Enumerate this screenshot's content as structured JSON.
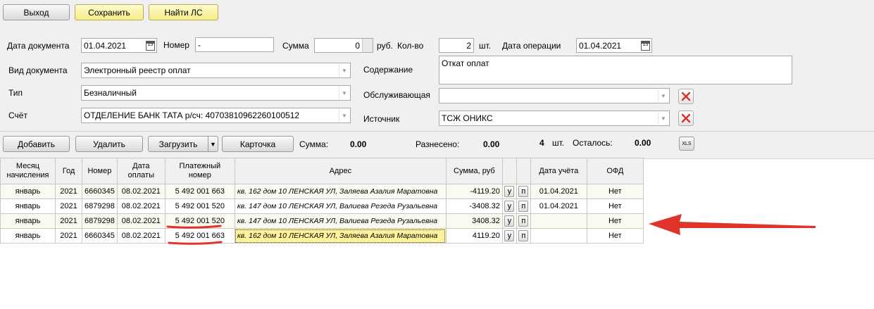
{
  "toolbar": {
    "exit_label": "Выход",
    "save_label": "Сохранить",
    "find_label": "Найти ЛС"
  },
  "form": {
    "doc_date_label": "Дата документа",
    "doc_date_value": "01.04.2021",
    "number_label": "Номер",
    "number_value": "-",
    "sum_label": "Сумма",
    "sum_value": "0",
    "sum_unit": "руб.",
    "count_label": "Кол-во",
    "count_value": "2",
    "count_unit": "шт.",
    "op_date_label": "Дата операции",
    "op_date_value": "01.04.2021",
    "doc_type_label": "Вид документа",
    "doc_type_value": "Электронный реестр оплат",
    "content_label": "Содержание",
    "content_value": "Откат оплат",
    "type_label": "Тип",
    "type_value": "Безналичный",
    "serving_label": "Обслуживающая",
    "serving_value": "",
    "account_label": "Счёт",
    "account_value": "ОТДЕЛЕНИЕ  БАНК ТАТА  р/сч: 40703810962260100512",
    "source_label": "Источник",
    "source_value": "ТСЖ ОНИКС",
    "calendar_text": "15"
  },
  "actions": {
    "add_label": "Добавить",
    "delete_label": "Удалить",
    "load_label": "Загрузить",
    "card_label": "Карточка",
    "sum_label": "Сумма:",
    "sum_value": "0.00",
    "distributed_label": "Разнесено:",
    "distributed_value": "0.00",
    "count_value": "4",
    "count_unit": "шт.",
    "remaining_label": "Осталось:",
    "remaining_value": "0.00",
    "xls_label": "XLS"
  },
  "table": {
    "headers": {
      "month": "Месяц начисления",
      "year": "Год",
      "number": "Номер",
      "pay_date": "Дата оплаты",
      "pay_number": "Платежный номер",
      "address": "Адрес",
      "amount": "Сумма, руб",
      "acc_date": "Дата учёта",
      "ofd": "ОФД"
    },
    "rows": [
      {
        "month": "январь",
        "year": "2021",
        "number": "6660345",
        "pay_date": "08.02.2021",
        "pay_number": "5 492 001 663",
        "address": "кв. 162 дом 10 ЛЕНСКАЯ УЛ, Заляева Азалия Маратовна",
        "amount": "-4119.20",
        "u": "у",
        "p": "п",
        "acc_date": "01.04.2021",
        "ofd": "Нет"
      },
      {
        "month": "январь",
        "year": "2021",
        "number": "6879298",
        "pay_date": "08.02.2021",
        "pay_number": "5 492 001 520",
        "address": "кв. 147 дом 10 ЛЕНСКАЯ УЛ, Валиева Резеда Рузальевна",
        "amount": "-3408.32",
        "u": "у",
        "p": "п",
        "acc_date": "01.04.2021",
        "ofd": "Нет"
      },
      {
        "month": "январь",
        "year": "2021",
        "number": "6879298",
        "pay_date": "08.02.2021",
        "pay_number": "5 492 001 520",
        "address": "кв. 147 дом 10 ЛЕНСКАЯ УЛ, Валиева Резеда Рузальевна",
        "amount": "3408.32",
        "u": "у",
        "p": "п",
        "acc_date": "",
        "ofd": "Нет"
      },
      {
        "month": "январь",
        "year": "2021",
        "number": "6660345",
        "pay_date": "08.02.2021",
        "pay_number": "5 492 001 663",
        "address": "кв. 162 дом 10 ЛЕНСКАЯ УЛ, Заляева Азалия Маратовна",
        "amount": "4119.20",
        "u": "у",
        "p": "п",
        "acc_date": "",
        "ofd": "Нет"
      }
    ]
  },
  "colors": {
    "annotation_red": "#e0342b",
    "selection_yellow": "#fff49a",
    "button_yellow": "#f5ec86"
  }
}
